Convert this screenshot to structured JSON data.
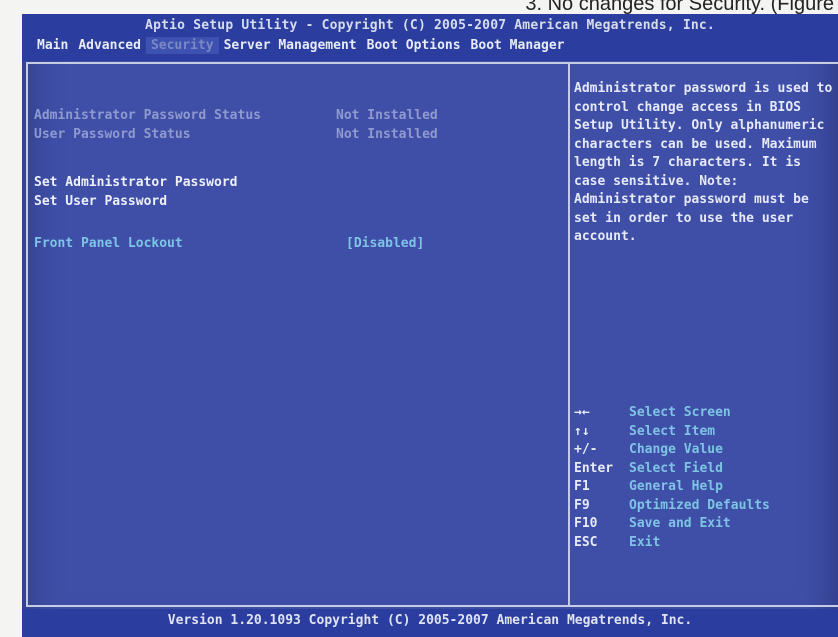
{
  "caption": "3. No changes for Security. (Figure",
  "header": {
    "title": "Aptio Setup Utility - Copyright (C) 2005-2007 American Megatrends, Inc.",
    "tabs": [
      "Main",
      "Advanced",
      "Security",
      "Server Management",
      "Boot Options",
      "Boot Manager"
    ],
    "active_tab": "Security"
  },
  "main": {
    "admin_status_label": "Administrator Password Status",
    "admin_status_value": "Not Installed",
    "user_status_label": "User Password Status",
    "user_status_value": "Not Installed",
    "set_admin": "Set Administrator Password",
    "set_user": "Set User Password",
    "front_panel_label": "Front Panel Lockout",
    "front_panel_value": "[Disabled]"
  },
  "help": {
    "text": "Administrator password is used to control change access in BIOS Setup Utility. Only alphanumeric characters can be used. Maximum length is 7 characters. It is case sensitive. Note: Administrator password must be set in order to use the user account.",
    "keys": [
      {
        "key": "→←",
        "desc": "Select Screen"
      },
      {
        "key": "↑↓",
        "desc": "Select Item"
      },
      {
        "key": "+/-",
        "desc": "Change Value"
      },
      {
        "key": "Enter",
        "desc": "Select Field"
      },
      {
        "key": "F1",
        "desc": "General Help"
      },
      {
        "key": "F9",
        "desc": "Optimized Defaults"
      },
      {
        "key": "F10",
        "desc": "Save and Exit"
      },
      {
        "key": "ESC",
        "desc": "Exit"
      }
    ]
  },
  "footer": {
    "text": "Version 1.20.1093 Copyright (C) 2005-2007 American Megatrends, Inc."
  },
  "colors": {
    "background": "#3f4fa8",
    "header": "#2b3ea0",
    "highlight_text": "#7ec4e4"
  }
}
